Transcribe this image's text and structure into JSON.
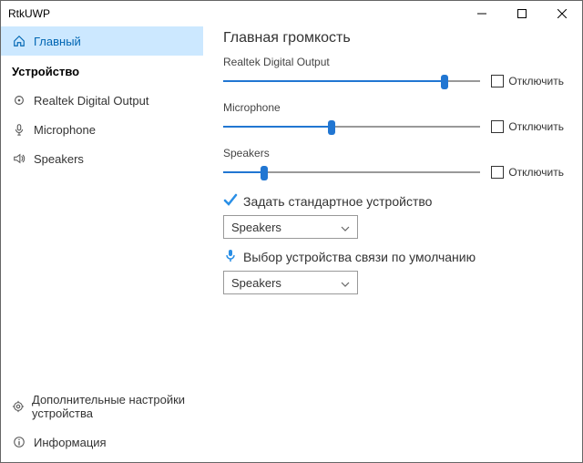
{
  "window": {
    "title": "RtkUWP"
  },
  "sidebar": {
    "main": "Главный",
    "heading": "Устройство",
    "items": [
      {
        "label": "Realtek Digital Output"
      },
      {
        "label": "Microphone"
      },
      {
        "label": "Speakers"
      }
    ],
    "advanced": "Дополнительные настройки устройства",
    "info": "Информация"
  },
  "main": {
    "heading": "Главная громкость",
    "sliders": [
      {
        "label": "Realtek Digital Output",
        "value": 86,
        "muteLabel": "Отключить"
      },
      {
        "label": "Microphone",
        "value": 42,
        "muteLabel": "Отключить"
      },
      {
        "label": "Speakers",
        "value": 16,
        "muteLabel": "Отключить"
      }
    ],
    "defaultDevice": {
      "title": "Задать стандартное устройство",
      "selected": "Speakers"
    },
    "commDevice": {
      "title": "Выбор устройства связи по умолчанию",
      "selected": "Speakers"
    }
  }
}
